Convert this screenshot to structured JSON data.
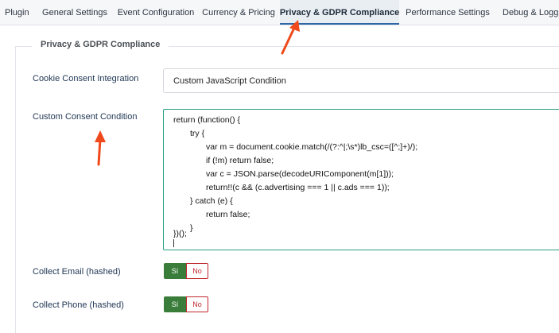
{
  "tabs": [
    {
      "label": "Plugin"
    },
    {
      "label": "General Settings"
    },
    {
      "label": "Event Configuration"
    },
    {
      "label": "Currency & Pricing"
    },
    {
      "label": "Privacy & GDPR Compliance",
      "active": true
    },
    {
      "label": "Performance Settings"
    },
    {
      "label": "Debug & Logging"
    }
  ],
  "section": {
    "legend": "Privacy & GDPR Compliance",
    "cookie_consent": {
      "label": "Cookie Consent Integration",
      "value": "Custom JavaScript Condition"
    },
    "custom_condition": {
      "label": "Custom Consent Condition",
      "code_lines": [
        "return (function() {",
        "try {",
        "var m = document.cookie.match(/(?:^|;\\s*)lb_csc=([^;]+)/);",
        "if (!m) return false;",
        "var c = JSON.parse(decodeURIComponent(m[1]));",
        "return!!(c && (c.advertising === 1 || c.ads === 1));",
        "} catch (e) {",
        "return false;",
        "}",
        "})();"
      ]
    },
    "collect_email": {
      "label": "Collect Email (hashed)",
      "yes": "Sí",
      "no": "No"
    },
    "collect_phone": {
      "label": "Collect Phone (hashed)",
      "yes": "Sí",
      "no": "No"
    }
  },
  "colors": {
    "accent": "#2f67a6",
    "toggle_yes": "#3a7d3a",
    "toggle_no": "#c0262d",
    "annotation_arrow": "#f04a1c"
  },
  "icons": [
    "annotation-arrow"
  ]
}
